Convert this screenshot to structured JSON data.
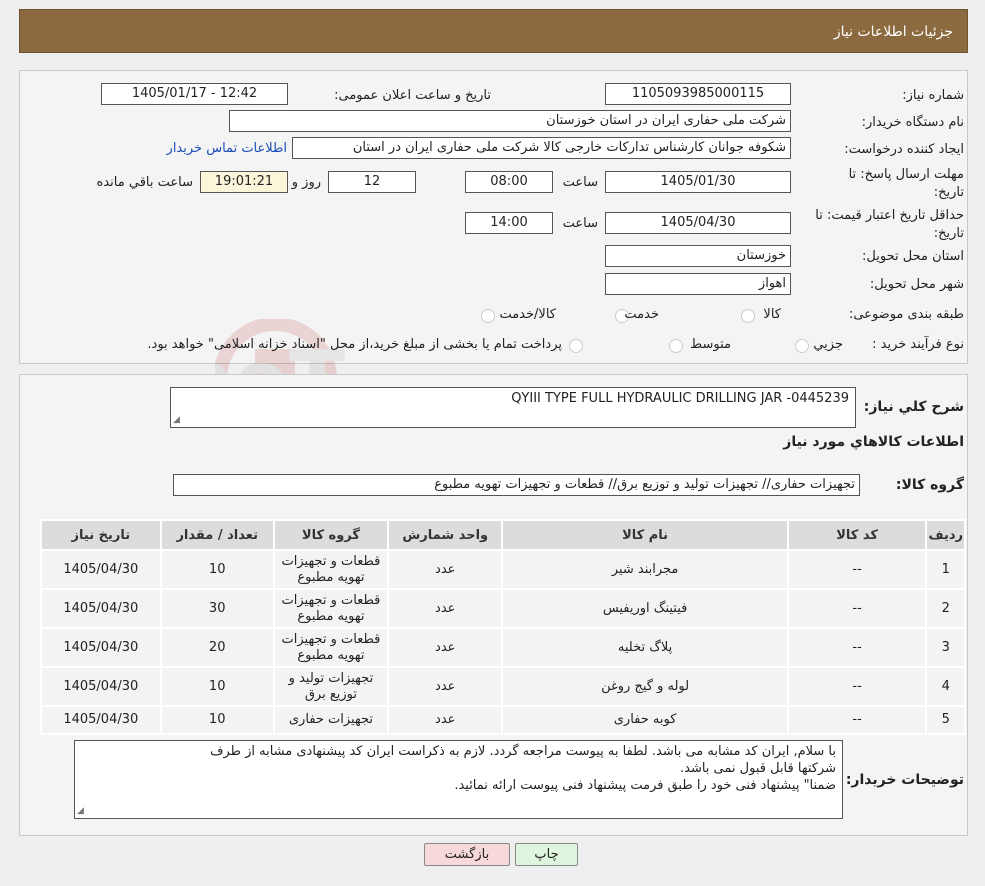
{
  "header": {
    "title": "جزئیات اطلاعات نیاز"
  },
  "info": {
    "need_number_label": "شماره نیاز:",
    "need_number_value": "1105093985000115",
    "announce_label": "تاریخ و ساعت اعلان عمومی:",
    "announce_value": "1405/01/17 - 12:42",
    "buyer_label": "نام دستگاه خریدار:",
    "buyer_value": "شرکت ملی حفاری ایران در استان خوزستان",
    "creator_label": "ایجاد کننده درخواست:",
    "creator_value": "شکوفه جوانان کارشناس تدارکات خارجی کالا شرکت ملی حفاری ایران در استان",
    "contact_link": "اطلاعات تماس خریدار",
    "deadline_label_1": "مهلت ارسال پاسخ: تا",
    "deadline_label_2": "تاریخ:",
    "deadline_date": "1405/01/30",
    "time_label": "ساعت",
    "deadline_time": "08:00",
    "days_value": "12",
    "days_label": "روز و",
    "remaining_value": "19:01:21",
    "remaining_label": "ساعت باقي مانده",
    "validity_label_1": "حداقل تاریخ اعتبار قیمت: تا",
    "validity_label_2": "تاریخ:",
    "validity_date": "1405/04/30",
    "validity_time": "14:00",
    "province_label": "استان محل تحویل:",
    "province_value": "خوزستان",
    "city_label": "شهر محل تحویل:",
    "city_value": "اهواز",
    "category_label": "طبقه بندی موضوعی:",
    "category_options": [
      "کالا",
      "خدمت",
      "کالا/خدمت"
    ],
    "process_label": "نوع فرآیند خرید :",
    "process_options": [
      "جزیي",
      "متوسط"
    ],
    "process_note": "پرداخت تمام یا بخشی از مبلغ خرید،از محل \"اسناد خزانه اسلامی\" خواهد بود."
  },
  "details": {
    "summary_label": "شرح کلي نیاز:",
    "summary_value": "QYIII TYPE FULL HYDRAULIC DRILLING JAR -0445239",
    "goods_info_title": "اطلاعات کالاهاي مورد نیاز",
    "goods_group_label": "گروه کالا:",
    "goods_group_value": "تجهیزات حفاری// تجهیزات تولید و توزیع برق//  قطعات و تجهیزات تهویه مطبوع",
    "table": {
      "headers": [
        "ردیف",
        "کد کالا",
        "نام کالا",
        "واحد شمارش",
        "گروه کالا",
        "تعداد / مقدار",
        "تاریخ نیاز"
      ],
      "rows": [
        [
          "1",
          "--",
          "مجرابند شیر",
          "عدد",
          "قطعات و تجهیزات تهویه مطبوع",
          "10",
          "1405/04/30"
        ],
        [
          "2",
          "--",
          "فیتینگ اوریفیس",
          "عدد",
          "قطعات و تجهیزات تهویه مطبوع",
          "30",
          "1405/04/30"
        ],
        [
          "3",
          "--",
          "پلاگ تخلیه",
          "عدد",
          "قطعات و تجهیزات تهویه مطبوع",
          "20",
          "1405/04/30"
        ],
        [
          "4",
          "--",
          "لوله و گیج روغن",
          "عدد",
          "تجهیزات تولید و توزیع برق",
          "10",
          "1405/04/30"
        ],
        [
          "5",
          "--",
          "کوبه حفاری",
          "عدد",
          "تجهیزات حفاری",
          "10",
          "1405/04/30"
        ]
      ]
    },
    "buyer_notes_label": "توضیحات خریدار:",
    "buyer_notes_lines": [
      "با سلام, ایران کد مشابه می باشد. لطفا به پیوست مراجعه گردد. لازم به ذکراست ایران کد پیشنهادی مشابه از طرف",
      "شرکتها قابل قبول نمی باشد.",
      "ضمنا\" پیشنهاد فنی خود را طبق فرمت پیشنهاد فنی پیوست ارائه نمائید."
    ]
  },
  "buttons": {
    "print": "چاپ",
    "back": "بازگشت"
  },
  "colors": {
    "header_bg": "#8b6a3f",
    "link": "#1a4fb8",
    "back_button_bg": "#f7d9d9",
    "print_button_bg": "#dff5df"
  }
}
